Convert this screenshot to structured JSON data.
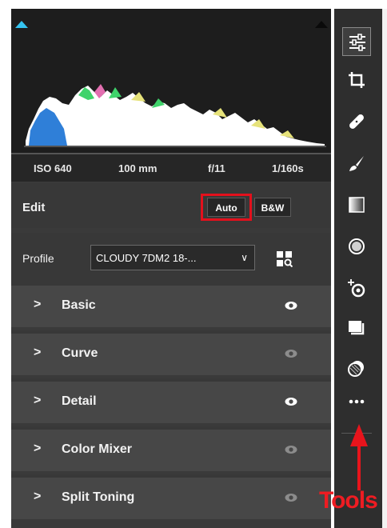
{
  "exif": {
    "iso": "ISO 640",
    "focal": "100 mm",
    "aperture": "f/11",
    "shutter": "1/160s"
  },
  "edit": {
    "label": "Edit",
    "auto_label": "Auto",
    "bw_label": "B&W"
  },
  "profile": {
    "label": "Profile",
    "value": "CLOUDY 7DM2 18-...",
    "browse_icon": "grid-search-icon"
  },
  "sections": [
    {
      "label": "Basic",
      "visible": true
    },
    {
      "label": "Curve",
      "visible": false
    },
    {
      "label": "Detail",
      "visible": true
    },
    {
      "label": "Color Mixer",
      "visible": false
    },
    {
      "label": "Split Toning",
      "visible": false
    }
  ],
  "toolbar": {
    "tools": [
      "edit-sliders-icon",
      "crop-icon",
      "healing-icon",
      "brush-icon",
      "linear-gradient-icon",
      "radial-gradient-icon",
      "red-eye-icon",
      "presets-icon",
      "snapshots-icon",
      "more-icon"
    ],
    "active": "edit-sliders-icon"
  },
  "annotation": {
    "label": "Tools",
    "color": "#ee1c22"
  },
  "colors": {
    "panel_bg": "#3a3a3a",
    "section_bg": "#474747",
    "toolbar_bg": "#2e2e2e",
    "highlight": "#e3101c"
  }
}
